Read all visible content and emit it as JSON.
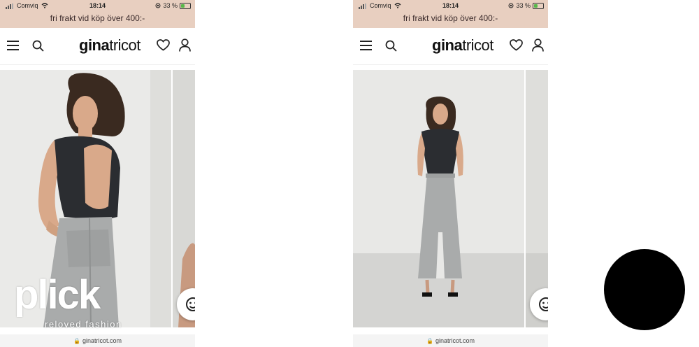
{
  "status_bar": {
    "carrier": "Comviq",
    "time": "18:14",
    "battery": "33 %"
  },
  "promo_text": "fri frakt vid köp över 400:-",
  "logo": {
    "bold": "gina",
    "light": "tricot"
  },
  "url": "ginatricot.com",
  "watermark": {
    "logo": "plick",
    "tagline": "reloved fashion"
  },
  "icons": [
    "signal-icon",
    "wifi-icon",
    "location-icon",
    "battery-icon",
    "hamburger-menu-icon",
    "search-icon",
    "heart-icon",
    "user-icon",
    "lock-icon",
    "face-icon"
  ],
  "colors": {
    "promo_bg": "#e8cfc0",
    "fab_bg": "#ffffff",
    "record_dot": "#000000"
  }
}
